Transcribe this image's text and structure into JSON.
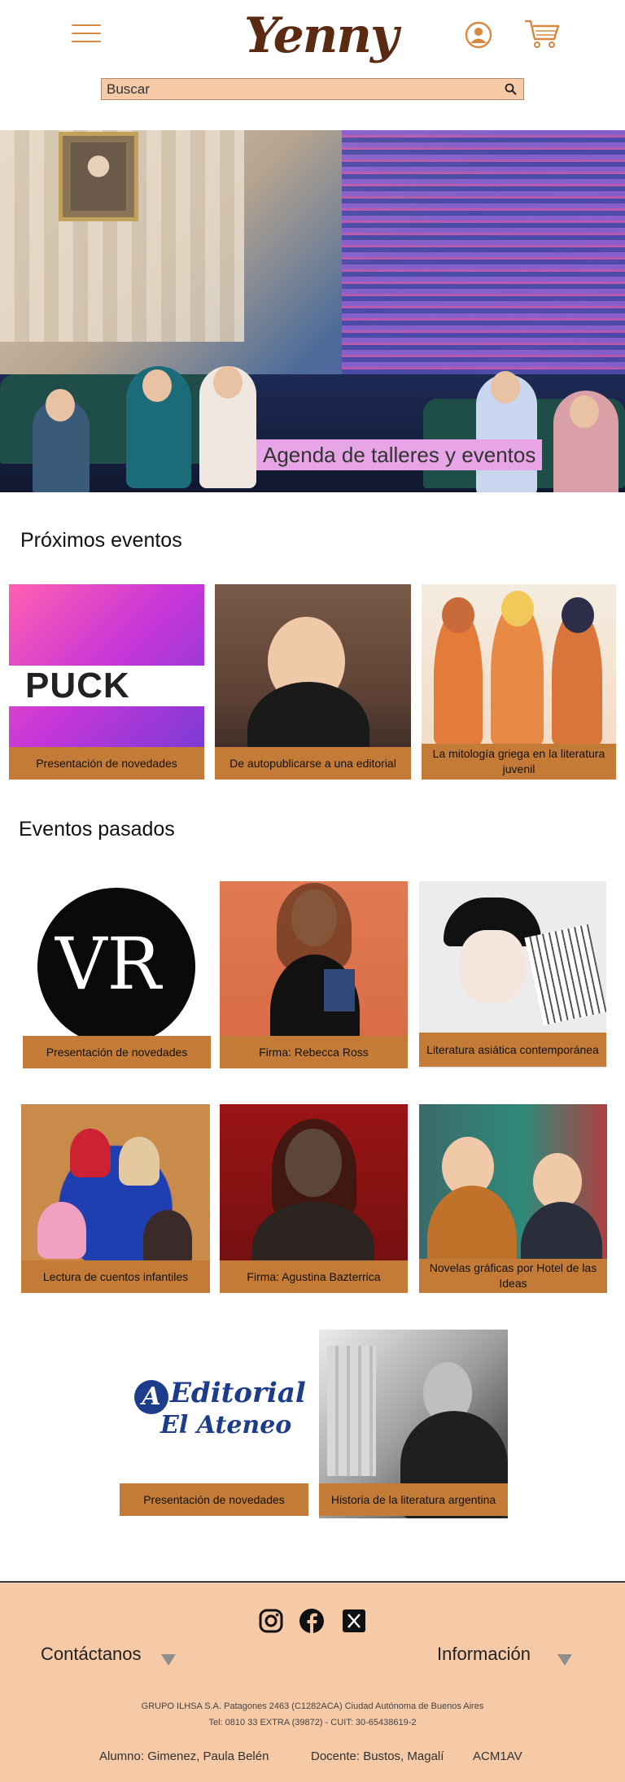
{
  "header": {
    "logo": "Yenny",
    "search_placeholder": "Buscar"
  },
  "hero": {
    "title": "Agenda de talleres y eventos"
  },
  "upcoming": {
    "title": "Próximos eventos",
    "cards": [
      {
        "label": "Presentación de novedades",
        "brand": "PUCK"
      },
      {
        "label": "De autopublicarse a una editorial"
      },
      {
        "label": "La mitología griega en la literatura juvenil"
      }
    ]
  },
  "past": {
    "title": "Eventos pasados",
    "cards": [
      {
        "label": "Presentación de novedades",
        "brand": "VR"
      },
      {
        "label": "Firma: Rebecca Ross"
      },
      {
        "label": "Literatura asiática contemporánea"
      },
      {
        "label": "Lectura de cuentos infantiles"
      },
      {
        "label": "Firma: Agustina Bazterrica"
      },
      {
        "label": "Novelas gráficas por Hotel de las Ideas"
      },
      {
        "label": "Presentación de novedades",
        "brand_line1": "Editorial",
        "brand_line2": "El Ateneo",
        "brand_mark": "A"
      },
      {
        "label": "Historia de la literatura argentina"
      }
    ]
  },
  "footer": {
    "contact": "Contáctanos",
    "info": "Información",
    "address_line1": "GRUPO ILHSA S.A. Patagones 2463 (C1282ACA) Ciudad Autónoma de Buenos Aires",
    "address_line2": "Tel: 0810 33 EXTRA (39872) - CUIT: 30-65438619-2",
    "student": "Alumno: Gimenez, Paula Belén",
    "teacher": "Docente: Bustos, Magalí",
    "course": "ACM1AV",
    "social_icons": [
      "instagram-icon",
      "facebook-icon",
      "x-icon"
    ]
  },
  "colors": {
    "accent": "#d9893f",
    "label_bg": "#c57b38",
    "search_bg": "#f6c9a7",
    "footer_bg": "#f6c9a7",
    "hero_title_bg": "#e7a4e6",
    "logo": "#5a2b12"
  }
}
